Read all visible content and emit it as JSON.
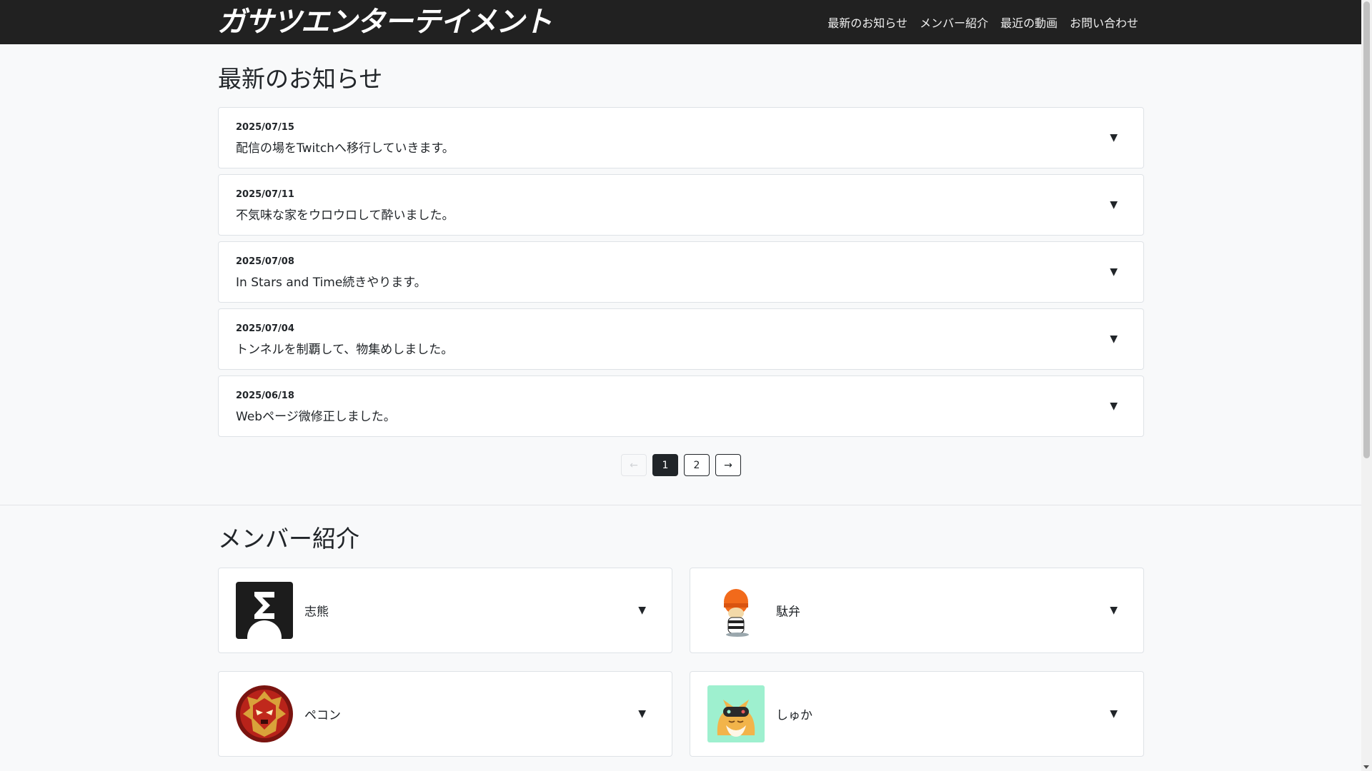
{
  "brand": "ガサツエンターテイメント",
  "nav": [
    "最新のお知らせ",
    "メンバー紹介",
    "最近の動画",
    "お問い合わせ"
  ],
  "news": {
    "title": "最新のお知らせ",
    "items": [
      {
        "date": "2025/07/15",
        "text": "配信の場をTwitchへ移行していきます。"
      },
      {
        "date": "2025/07/11",
        "text": "不気味な家をウロウロして酔いました。"
      },
      {
        "date": "2025/07/08",
        "text": "In Stars and Time続きやります。"
      },
      {
        "date": "2025/07/04",
        "text": "トンネルを制覇して、物集めしました。"
      },
      {
        "date": "2025/06/18",
        "text": "Webページ微修正しました。"
      }
    ],
    "expand_glyph": "▼",
    "pagination": {
      "prev": "←",
      "pages": [
        "1",
        "2"
      ],
      "next": "→",
      "current": 1
    }
  },
  "members": {
    "title": "メンバー紹介",
    "items": [
      {
        "name": "志熊",
        "avatar_icon": "sigma-avatar-icon"
      },
      {
        "name": "駄弁",
        "avatar_icon": "orange-helmet-character-icon"
      },
      {
        "name": "ペコン",
        "avatar_icon": "red-mask-emblem-icon"
      },
      {
        "name": "しゅか",
        "avatar_icon": "fox-with-gamepad-icon"
      }
    ]
  },
  "colors": {
    "navbar": "#212121",
    "background": "#f8f9fa",
    "card": "#ffffff",
    "border": "#dee2e6",
    "active_page": "#212529"
  }
}
